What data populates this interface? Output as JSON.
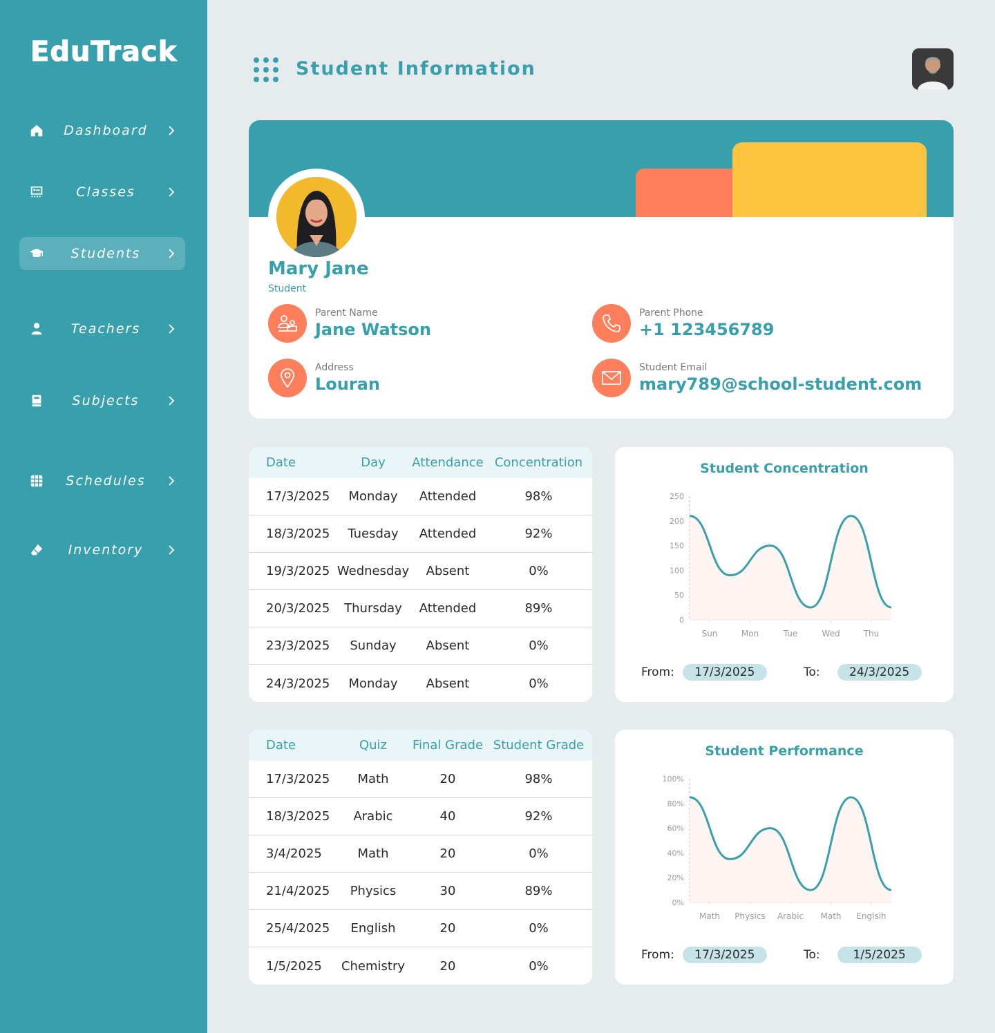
{
  "app": {
    "logo": "EduTrack"
  },
  "sidebar": {
    "items": [
      {
        "label": "Dashboard",
        "icon": "home-icon",
        "active": false
      },
      {
        "label": "Classes",
        "icon": "classes-icon",
        "active": false
      },
      {
        "label": "Students",
        "icon": "graduation-cap-icon",
        "active": true
      },
      {
        "label": "Teachers",
        "icon": "user-icon",
        "active": false
      },
      {
        "label": "Subjects",
        "icon": "book-icon",
        "active": false
      },
      {
        "label": "Schedules",
        "icon": "grid-icon",
        "active": false
      },
      {
        "label": "Inventory",
        "icon": "eraser-icon",
        "active": false
      }
    ]
  },
  "header": {
    "title": "Student Information"
  },
  "profile": {
    "name": "Mary Jane",
    "role": "Student",
    "parent_name_label": "Parent Name",
    "parent_name": "Jane Watson",
    "parent_phone_label": "Parent Phone",
    "parent_phone": "+1 123456789",
    "address_label": "Address",
    "address": "Louran",
    "email_label": "Student Email",
    "email": "mary789@school-student.com"
  },
  "colors": {
    "primary": "#389fad",
    "accent": "#ff7f5c",
    "yellow": "#fcc43f",
    "background": "#e6ebee"
  },
  "attendance": {
    "headers": [
      "Date",
      "Day",
      "Attendance",
      "Concentration"
    ],
    "rows": [
      [
        "17/3/2025",
        "Monday",
        "Attended",
        "98%"
      ],
      [
        "18/3/2025",
        "Tuesday",
        "Attended",
        "92%"
      ],
      [
        "19/3/2025",
        "Wednesday",
        "Absent",
        "0%"
      ],
      [
        "20/3/2025",
        "Thursday",
        "Attended",
        "89%"
      ],
      [
        "23/3/2025",
        "Sunday",
        "Absent",
        "0%"
      ],
      [
        "24/3/2025",
        "Monday",
        "Absent",
        "0%"
      ]
    ]
  },
  "grades": {
    "headers": [
      "Date",
      "Quiz",
      "Final Grade",
      "Student Grade"
    ],
    "rows": [
      [
        "17/3/2025",
        "Math",
        "20",
        "98%"
      ],
      [
        "18/3/2025",
        "Arabic",
        "40",
        "92%"
      ],
      [
        "3/4/2025",
        "Math",
        "20",
        "0%"
      ],
      [
        "21/4/2025",
        "Physics",
        "30",
        "89%"
      ],
      [
        "25/4/2025",
        "English",
        "20",
        "0%"
      ],
      [
        "1/5/2025",
        "Chemistry",
        "20",
        "0%"
      ]
    ]
  },
  "concentration_range": {
    "from_label": "From:",
    "from": "17/3/2025",
    "to_label": "To:",
    "to": "24/3/2025"
  },
  "performance_range": {
    "from_label": "From:",
    "from": "17/3/2025",
    "to_label": "To:",
    "to": "1/5/2025"
  },
  "chart_data": [
    {
      "type": "line",
      "title": "Student Concentration",
      "categories": [
        "Sun",
        "Mon",
        "Tue",
        "Wed",
        "Thu"
      ],
      "yticks": [
        "0",
        "50",
        "100",
        "150",
        "200",
        "250"
      ],
      "ylim": [
        0,
        250
      ],
      "x": [
        0,
        0.2,
        0.4,
        0.6,
        0.8,
        1.0
      ],
      "values": [
        210,
        90,
        150,
        25,
        210,
        25
      ],
      "grid": false
    },
    {
      "type": "line",
      "title": "Student Performance",
      "categories": [
        "Math",
        "Physics",
        "Arabic",
        "Math",
        "Englsih"
      ],
      "yticks": [
        "0%",
        "20%",
        "40%",
        "60%",
        "80%",
        "100%"
      ],
      "ylim": [
        0,
        100
      ],
      "x": [
        0,
        0.2,
        0.4,
        0.6,
        0.8,
        1.0
      ],
      "values": [
        85,
        35,
        60,
        10,
        85,
        10
      ],
      "grid": false
    }
  ]
}
